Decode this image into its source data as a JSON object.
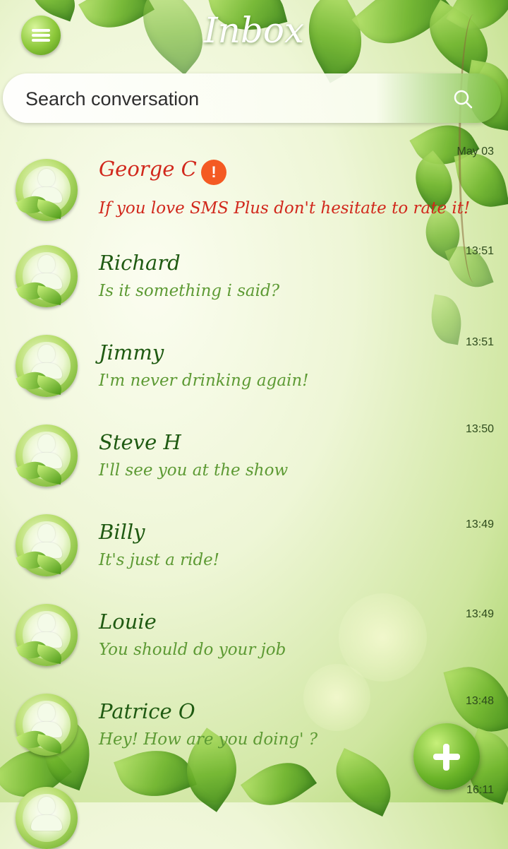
{
  "header": {
    "title": "Inbox",
    "menu_icon": "hamburger-menu-icon"
  },
  "search": {
    "placeholder": "Search conversation",
    "value": "",
    "icon": "search-icon"
  },
  "conversations": [
    {
      "name": "George C",
      "preview": "If you love SMS Plus don't hesitate to rate it!",
      "time": "May 03",
      "unread": true,
      "alert_icon": "alert-icon",
      "alert_glyph": "!"
    },
    {
      "name": "Richard",
      "preview": "Is it something i said?",
      "time": "13:51",
      "unread": false
    },
    {
      "name": "Jimmy",
      "preview": "I'm never drinking again!",
      "time": "13:51",
      "unread": false
    },
    {
      "name": "Steve H",
      "preview": "I'll see you at the show",
      "time": "13:50",
      "unread": false
    },
    {
      "name": "Billy",
      "preview": "It's just a ride!",
      "time": "13:49",
      "unread": false
    },
    {
      "name": "Louie",
      "preview": "You should do your job",
      "time": "13:49",
      "unread": false
    },
    {
      "name": "Patrice O",
      "preview": "Hey! How are you doing' ?",
      "time": "13:48",
      "unread": false
    }
  ],
  "partial_row": {
    "time": "16:11"
  },
  "fab": {
    "icon": "plus-icon"
  },
  "colors": {
    "unread": "#d1281c",
    "name": "#1f5a12",
    "preview": "#5d9a34",
    "accent_green": "#6cb529",
    "alert_badge": "#f45a23"
  }
}
